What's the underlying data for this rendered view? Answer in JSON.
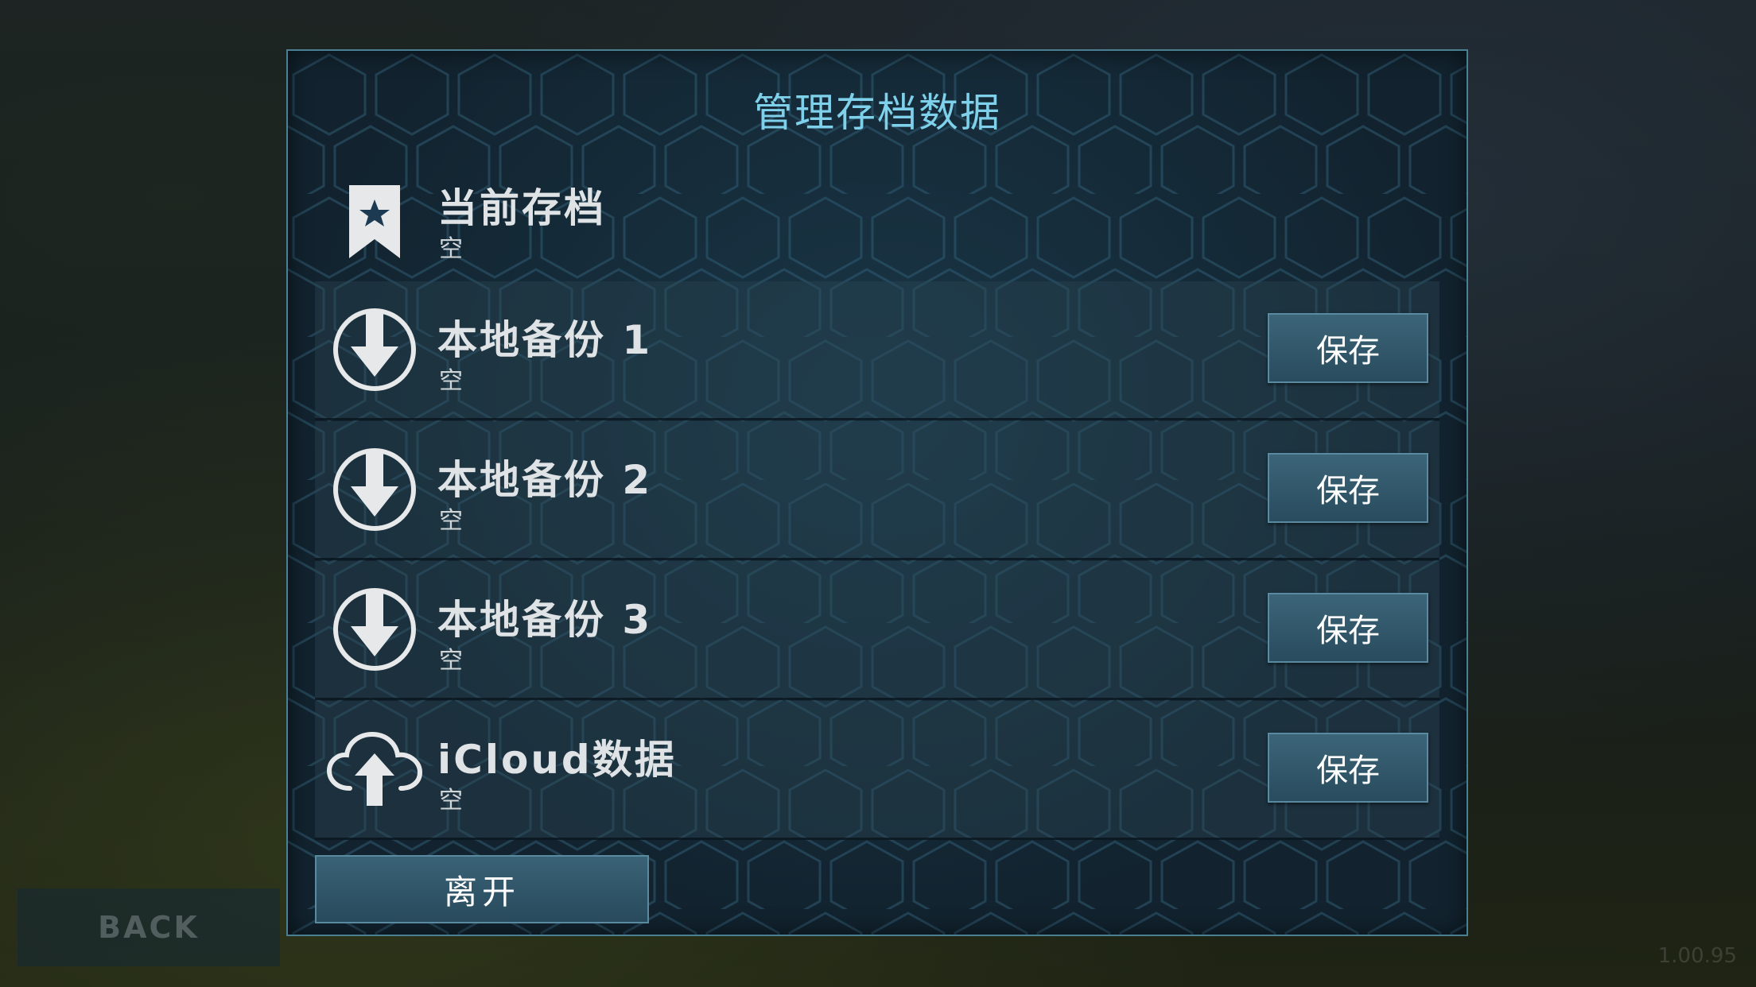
{
  "background": {
    "back_label": "BACK",
    "version": "1.00.95"
  },
  "dialog": {
    "title": "管理存档数据",
    "current_save": {
      "label": "当前存档",
      "status": "空",
      "icon": "bookmark-star-icon"
    },
    "slots": [
      {
        "label": "本地备份 1",
        "status": "空",
        "button": "保存",
        "icon": "download-icon"
      },
      {
        "label": "本地备份 2",
        "status": "空",
        "button": "保存",
        "icon": "download-icon"
      },
      {
        "label": "本地备份 3",
        "status": "空",
        "button": "保存",
        "icon": "download-icon"
      },
      {
        "label": "iCloud数据",
        "status": "空",
        "button": "保存",
        "icon": "cloud-upload-icon"
      }
    ],
    "leave_label": "离开"
  },
  "colors": {
    "title": "#7fd0ea",
    "border": "#4b7f92",
    "button": "#2f566a"
  }
}
